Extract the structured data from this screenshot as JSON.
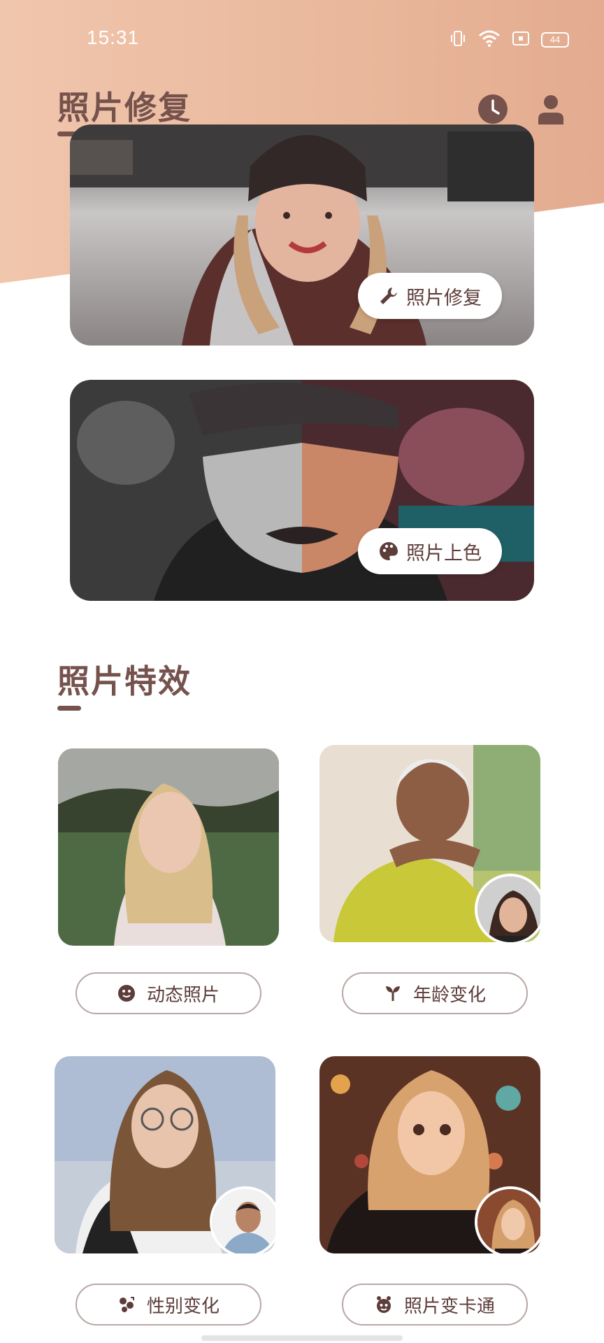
{
  "status": {
    "time": "15:31",
    "battery": "44"
  },
  "header": {
    "title": "照片修复"
  },
  "features": [
    {
      "label": "照片修复",
      "icon": "wrench-icon"
    },
    {
      "label": "照片上色",
      "icon": "palette-icon"
    }
  ],
  "effects_section": {
    "title": "照片特效"
  },
  "effects": [
    {
      "label": "动态照片",
      "icon": "smiley-icon"
    },
    {
      "label": "年龄变化",
      "icon": "sprout-icon"
    },
    {
      "label": "性别变化",
      "icon": "gender-icon"
    },
    {
      "label": "照片变卡通",
      "icon": "cartoon-face-icon"
    }
  ],
  "colors": {
    "accent": "#76524d",
    "header_bg": "#eab99e",
    "button_border": "#b9a7a5"
  }
}
